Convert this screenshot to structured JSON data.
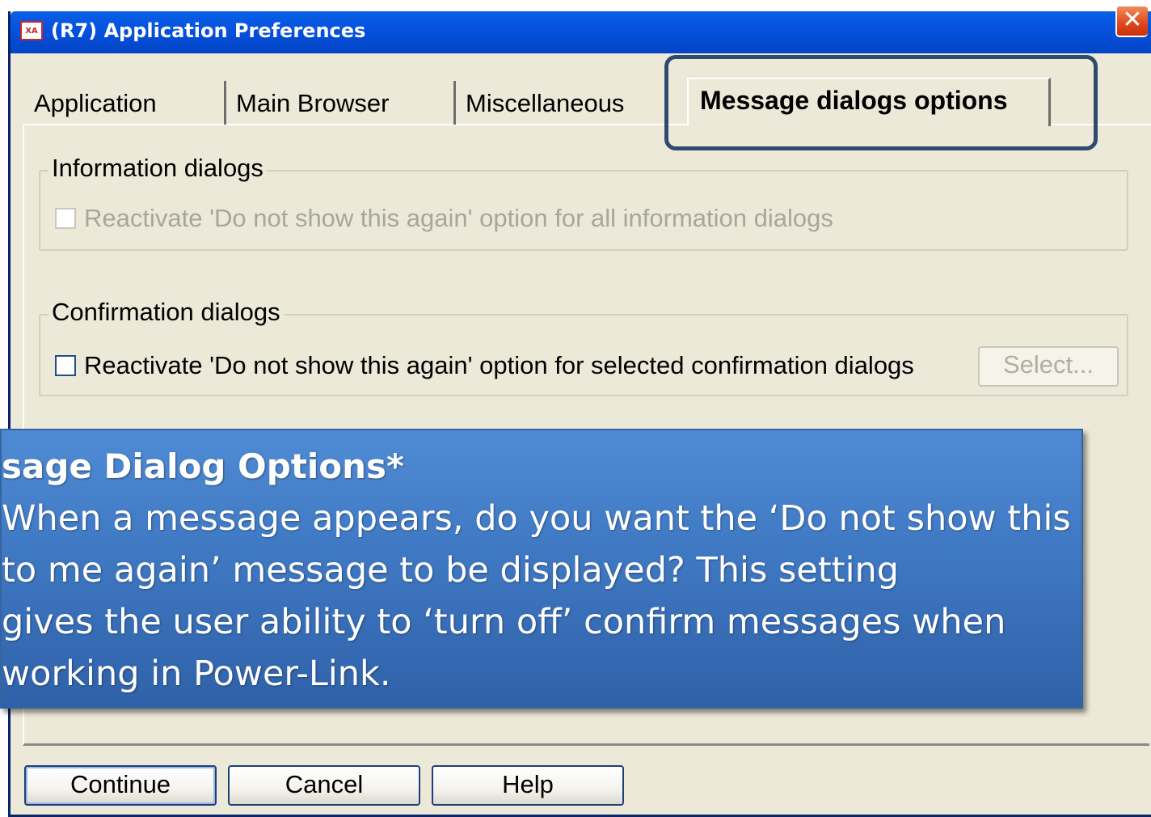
{
  "window": {
    "app_icon_text": "XA",
    "title": "(R7) Application Preferences",
    "close_glyph": "✕"
  },
  "tabs": [
    {
      "label": "Application",
      "active": false
    },
    {
      "label": "Main Browser",
      "active": false
    },
    {
      "label": "Miscellaneous",
      "active": false
    },
    {
      "label": "Message dialogs options",
      "active": true
    }
  ],
  "info_group": {
    "legend": "Information dialogs",
    "checkbox_label": "Reactivate 'Do not show this again' option for all information dialogs",
    "checked": false,
    "enabled": false
  },
  "confirm_group": {
    "legend": "Confirmation dialogs",
    "checkbox_label": "Reactivate 'Do not show this again' option for selected confirmation dialogs",
    "checked": false,
    "enabled": true,
    "select_button": "Select..."
  },
  "callout": {
    "title": "sage Dialog Options*",
    "lines": [
      "When a message appears, do you want the ‘Do not show this",
      "to me again’ message to be displayed? This setting",
      "gives the user ability to ‘turn off’ confirm messages when",
      "working in Power-Link."
    ]
  },
  "buttons": {
    "continue": "Continue",
    "cancel": "Cancel",
    "help": "Help"
  },
  "colors": {
    "titlebar": "#0551de",
    "dialog_bg": "#ece9d8",
    "callout_bg": "#3f78c2",
    "highlight_border": "#2e4a6f"
  }
}
